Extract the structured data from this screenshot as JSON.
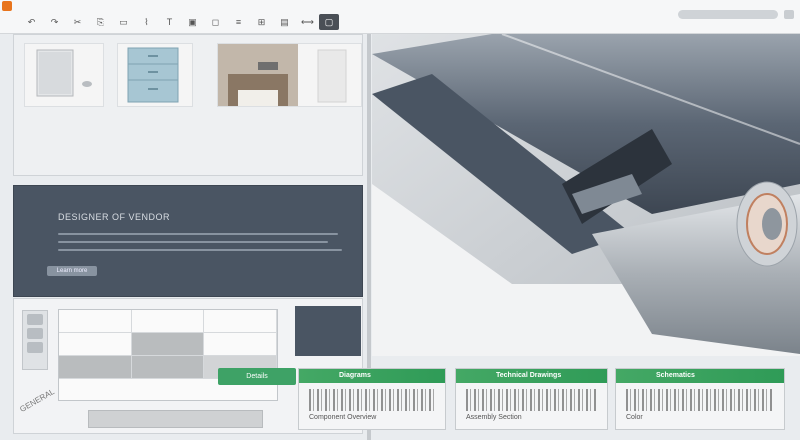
{
  "toolbar": {
    "items": [
      {
        "icon": "undo-icon",
        "glyph": "↶"
      },
      {
        "icon": "redo-icon",
        "glyph": "↷"
      },
      {
        "icon": "cut-icon",
        "glyph": "✂"
      },
      {
        "icon": "copy-icon",
        "glyph": "⎘"
      },
      {
        "icon": "paste-icon",
        "glyph": "▭"
      },
      {
        "icon": "brush-icon",
        "glyph": "⌇"
      },
      {
        "icon": "text-icon",
        "glyph": "T"
      },
      {
        "icon": "image-icon",
        "glyph": "▣"
      },
      {
        "icon": "shape-icon",
        "glyph": "◻"
      },
      {
        "icon": "align-icon",
        "glyph": "≡"
      },
      {
        "icon": "grid-icon",
        "glyph": "⊞"
      },
      {
        "icon": "layer-icon",
        "glyph": "▤"
      },
      {
        "icon": "ruler-icon",
        "glyph": "⟷"
      },
      {
        "icon": "view-icon",
        "glyph": "▢"
      }
    ]
  },
  "panel": {
    "title": "DESIGNER OF VENDOR",
    "button": "Learn more"
  },
  "form": {
    "label": "GENERAL"
  },
  "chips": {
    "green": "Details"
  },
  "cards": [
    {
      "tab": "Diagrams",
      "caption": "Component Overview"
    },
    {
      "tab": "Technical Drawings",
      "caption": "Assembly Section"
    },
    {
      "tab": "Schematics",
      "caption": "Color"
    }
  ],
  "colors": {
    "accent": "#3ea266",
    "panel": "#4a5563",
    "brand": "#e8741c"
  }
}
